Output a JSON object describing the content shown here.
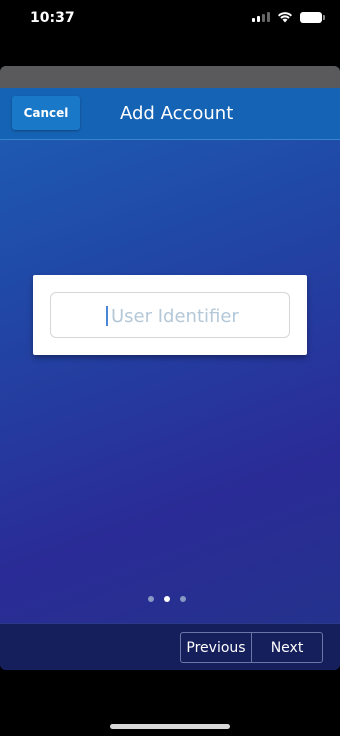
{
  "status_bar": {
    "time": "10:37"
  },
  "header": {
    "cancel_label": "Cancel",
    "title": "Add Account"
  },
  "form": {
    "user_identifier_placeholder": "User Identifier",
    "user_identifier_value": ""
  },
  "pager": {
    "total_pages": 3,
    "current_page": 2
  },
  "footer": {
    "previous_label": "Previous",
    "next_label": "Next"
  },
  "colors": {
    "header_bg": "#1563b4",
    "footer_bg": "#151f5c",
    "gradient_top": "#1c61b7",
    "gradient_bottom": "#2a2b96"
  }
}
